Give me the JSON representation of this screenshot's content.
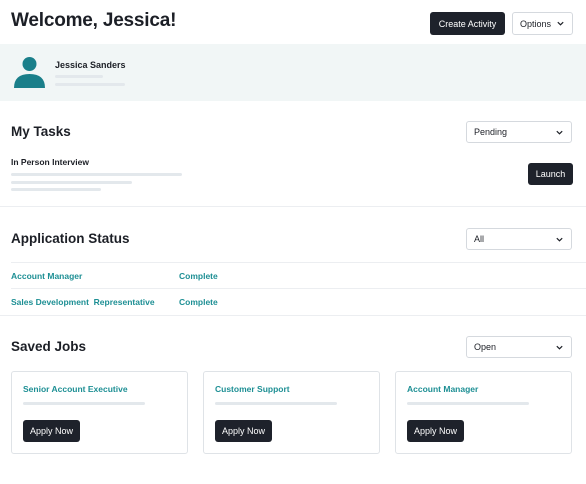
{
  "header": {
    "title": "Welcome, Jessica!",
    "create_activity_label": "Create Activity",
    "options_label": "Options"
  },
  "profile": {
    "name": "Jessica Sanders",
    "avatar_icon": "person-icon",
    "accent_color": "#1a7f8a"
  },
  "tasks": {
    "title": "My Tasks",
    "filter_value": "Pending",
    "items": [
      {
        "label": "In Person Interview",
        "action_label": "Launch"
      }
    ]
  },
  "application_status": {
    "title": "Application Status",
    "filter_value": "All",
    "rows": [
      {
        "job": "Account Manager",
        "status": "Complete"
      },
      {
        "job": "Sales Development  Representative",
        "status": "Complete"
      }
    ]
  },
  "saved_jobs": {
    "title": "Saved Jobs",
    "filter_value": "Open",
    "cards": [
      {
        "title": "Senior Account Executive",
        "action_label": "Apply Now"
      },
      {
        "title": "Customer Support",
        "action_label": "Apply Now"
      },
      {
        "title": "Account Manager",
        "action_label": "Apply Now"
      }
    ]
  },
  "colors": {
    "teal_text": "#1d8f94",
    "dark_button": "#1e222b",
    "profile_background": "#f1f6f6"
  }
}
